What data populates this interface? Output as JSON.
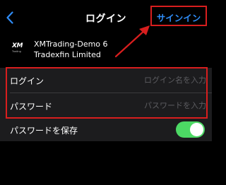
{
  "nav": {
    "title": "ログイン",
    "sign_in_label": "サインイン",
    "back_icon": "chevron-left-icon"
  },
  "server": {
    "logo_text": "XM",
    "logo_subtext": "Trading",
    "name": "XMTrading-Demo 6",
    "company": "Tradexfin Limited"
  },
  "fields": {
    "login": {
      "label": "ログイン",
      "placeholder": "ログイン名を入力",
      "value": ""
    },
    "password": {
      "label": "パスワード",
      "placeholder": "パスワードを入力",
      "value": ""
    }
  },
  "save_password": {
    "label": "パスワードを保存",
    "enabled": true
  },
  "colors": {
    "background": "#000000",
    "group_background": "#1c1c1e",
    "accent": "#2f8cf6",
    "highlight": "#d81e1e",
    "toggle_on": "#4cd964"
  }
}
